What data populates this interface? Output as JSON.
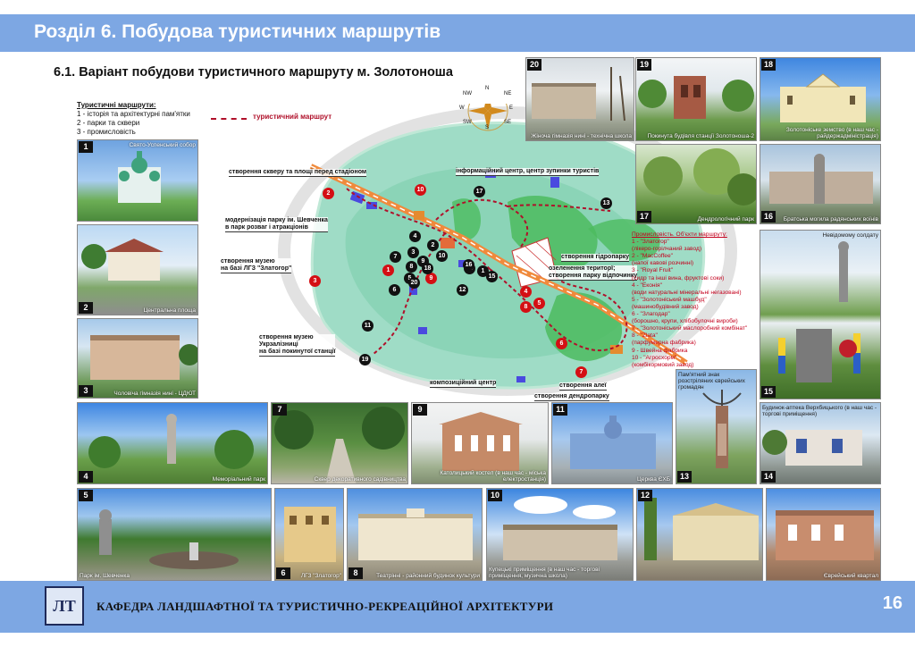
{
  "header": {
    "title": "Розділ 6. Побудова туристичних маршрутів"
  },
  "subtitle": "6.1. Варіант побудови туристичного маршруту м. Золотоноша",
  "legend": {
    "title": "Туристичні маршрути:",
    "items": [
      "1 - історія та архітектурні пам'ятки",
      "2 - парки та сквери",
      "3 - промисловість"
    ],
    "route_label": "туристичний маршрут"
  },
  "callouts": {
    "c1": "створення скверу та площі перед стадіоном",
    "c2": "модернізація парку ім. Шевченка",
    "c2b": "в парк розваг і атракціонів",
    "c3": "створення музею",
    "c3b": "на базі ЛГЗ \"Златогор\"",
    "c4": "створення музею",
    "c4b": "Укрзалізниці",
    "c4c": "на базі покинутої станції",
    "c5": "інформаційний центр, центр зупинки туристів",
    "c6": "створення гідропарку",
    "c7": "озеленення територї;",
    "c7b": "створення парку відпочинку",
    "c8": "створення алеї",
    "c9": "створення дендропарку",
    "c10": "композиційний центр"
  },
  "compass": {
    "n": "N",
    "s": "S",
    "e": "E",
    "w": "W",
    "nw": "NW",
    "ne": "NE",
    "sw": "SW",
    "se": "SE"
  },
  "industry": {
    "title": "Промисловість. Об'єкти маршруту:",
    "lines": [
      "1 - \"Златогор\"",
      "(лікеро-горілчаний завод)",
      "2 - \"MacCoffee\"",
      "(напої кавові розчинні)",
      "3 - \"Royal Fruit\"",
      "(сидр та інші вина, фруктові соки)",
      "4 - \"Еконія\"",
      "(води натуральні мінеральні негазовані)",
      "5 - \"Золотоніський машбуд\"",
      "(машинобудівний завод)",
      "6 - \"Злагодар\"",
      "(борошно, крупи, хлібобулочні вироби)",
      "7 - \"Золотоніський маслоробний комбінат\"",
      "8 - \"Zlata\"",
      "(парфумерна фабрика)",
      "9 - Швейна фабрика",
      "10 - \"Агросхорм\"",
      "(комбікормовий завод)"
    ]
  },
  "photos": {
    "p1": {
      "num": "1",
      "cap": "Свято-Успенський собор"
    },
    "p2": {
      "num": "2",
      "cap": "Центральна площа"
    },
    "p3": {
      "num": "3",
      "cap": "Чоловіча гімназія нині - ЦДЮТ"
    },
    "p4": {
      "num": "4",
      "cap": "Меморіальний парк"
    },
    "p5": {
      "num": "5",
      "cap": "Парк ім. Шевченка"
    },
    "p6": {
      "num": "6",
      "cap": "ЛГЗ \"Златогор\""
    },
    "p7": {
      "num": "7",
      "cap": "Сквер декоративного садівництва"
    },
    "p8": {
      "num": "8",
      "cap": "Театрінні - районний будинок культури"
    },
    "p9": {
      "num": "9",
      "cap": "Католицький костел (в наш час - міська електростанція)"
    },
    "p10": {
      "num": "10",
      "cap": "Купецькі приміщення (в наш час - торгові приміщення, музична школа)"
    },
    "p11": {
      "num": "11",
      "cap": "Церква ЄХБ"
    },
    "p12": {
      "num": "12",
      "cap": ""
    },
    "p12b": {
      "cap": "Єврейський квартал"
    },
    "p13": {
      "num": "13",
      "cap": "Пам'ятний знак розстріляних єврейських громадян"
    },
    "p14": {
      "num": "14",
      "cap": "Будинок-аптека Верхбицького (в наш час - торгові приміщення)"
    },
    "p15": {
      "num": "15",
      "cap": "Невідомому солдату"
    },
    "p16": {
      "num": "16",
      "cap": "Братська могила радянських воїнів"
    },
    "p17": {
      "num": "17",
      "cap": "Дендрологічний парк"
    },
    "p18": {
      "num": "18",
      "cap": "Золотоніське земство (в наш час - райдержадміністрація)"
    },
    "p19": {
      "num": "19",
      "cap": "Покинута будівля станції Золотоноша-2"
    },
    "p20": {
      "num": "20",
      "cap": "Жіноча гімназія нині - технічна школа"
    }
  },
  "map_markers": {
    "red": [
      "1",
      "2",
      "3",
      "4",
      "5",
      "6",
      "7",
      "8",
      "9",
      "10"
    ],
    "black": [
      "1",
      "2",
      "3",
      "4",
      "5",
      "6",
      "7",
      "8",
      "9",
      "10",
      "11",
      "12",
      "13",
      "14",
      "15",
      "16",
      "17",
      "18",
      "19",
      "20"
    ]
  },
  "footer": {
    "text": "КАФЕДРА ЛАНДШАФТНОЇ ТА ТУРИСТИЧНО-РЕКРЕАЦІЙНОЇ АРХІТЕКТУРИ",
    "page": "16",
    "logo_letters": "ЛТ"
  },
  "colors": {
    "banner": "#7da7e3",
    "route": "#b0102a",
    "marker_red": "#d40f14",
    "green": "#6fc48a"
  }
}
